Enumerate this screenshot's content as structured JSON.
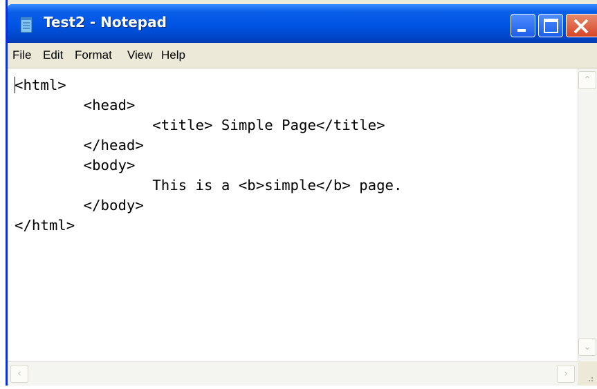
{
  "window": {
    "title": "Test2 - Notepad",
    "icon": "notepad-icon"
  },
  "menu": [
    "File",
    "Edit",
    "Format",
    "View",
    "Help"
  ],
  "document": {
    "lines": [
      "<html>",
      "\t<head>",
      "\t\t<title> Simple Page</title>",
      "\t</head>",
      "\t<body>",
      "\t\tThis is a <b>simple</b> page.",
      "\t</body>",
      "</html>"
    ]
  },
  "colors": {
    "titlebar": "#0054e3",
    "close_button": "#d6452a"
  }
}
